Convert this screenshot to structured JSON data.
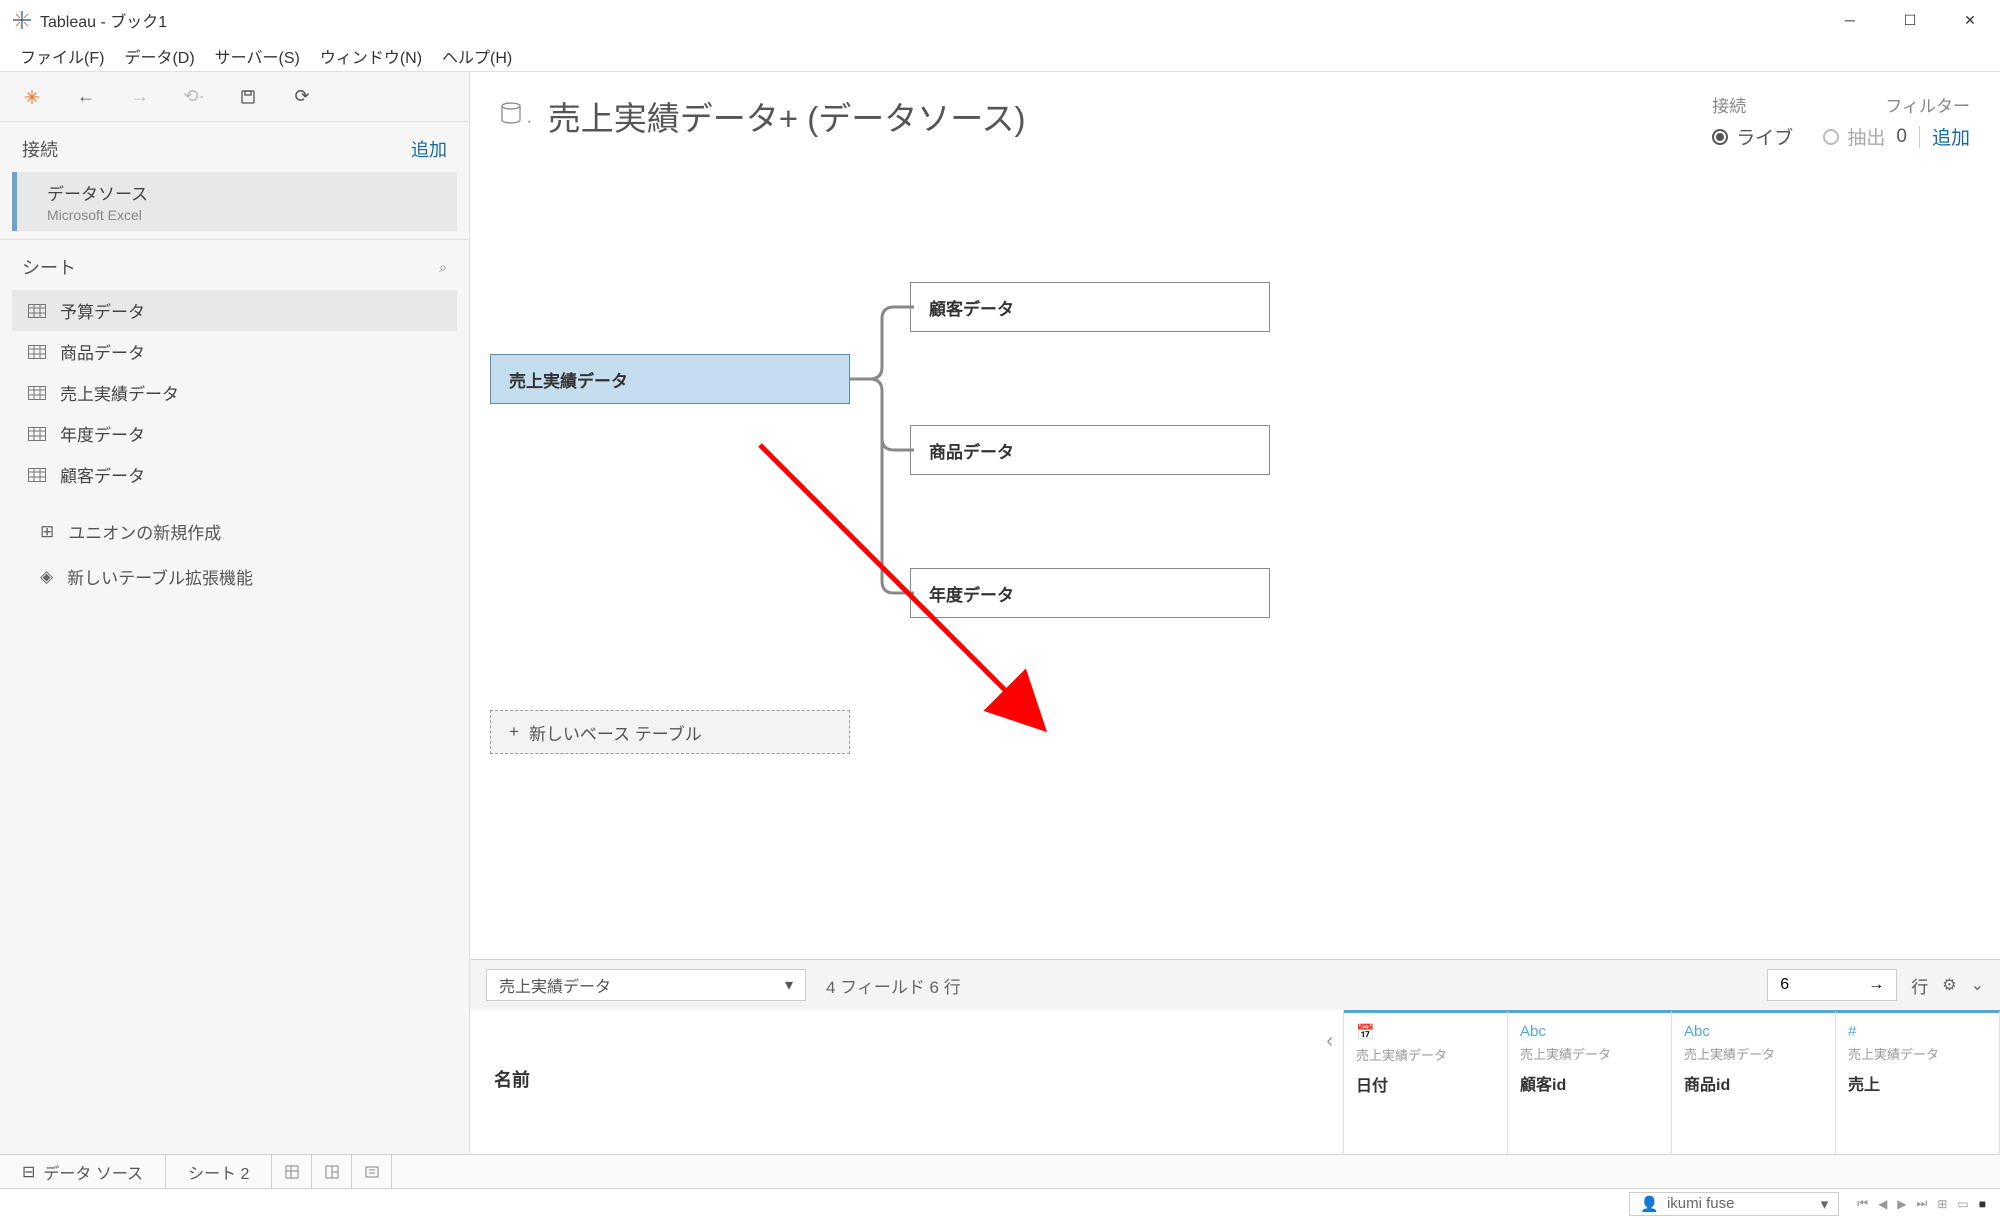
{
  "window": {
    "title": "Tableau - ブック1"
  },
  "menu": {
    "file": "ファイル(F)",
    "data": "データ(D)",
    "server": "サーバー(S)",
    "window": "ウィンドウ(N)",
    "help": "ヘルプ(H)"
  },
  "sidebar": {
    "connections_label": "接続",
    "add": "追加",
    "conn_name": "データソース",
    "conn_type": "Microsoft Excel",
    "sheets_label": "シート",
    "sheets": [
      {
        "label": "予算データ"
      },
      {
        "label": "商品データ"
      },
      {
        "label": "売上実績データ"
      },
      {
        "label": "年度データ"
      },
      {
        "label": "顧客データ"
      }
    ],
    "union": "ユニオンの新規作成",
    "extension": "新しいテーブル拡張機能"
  },
  "datasource": {
    "title": "売上実績データ+ (データソース)",
    "conn_label": "接続",
    "live": "ライブ",
    "extract": "抽出",
    "filter_label": "フィルター",
    "filter_count": "0",
    "filter_add": "追加"
  },
  "canvas": {
    "root": "売上実績データ",
    "n1": "顧客データ",
    "n2": "商品データ",
    "n3": "年度データ",
    "new_base": "新しいベース テーブル"
  },
  "preview": {
    "select": "売上実績データ",
    "info": "4 フィールド 6 行",
    "rows_value": "6",
    "rows_label": "行",
    "name_label": "名前",
    "cols": [
      {
        "icon": "date",
        "src": "売上実績データ",
        "name": "日付"
      },
      {
        "icon": "abc",
        "src": "売上実績データ",
        "name": "顧客id"
      },
      {
        "icon": "abc",
        "src": "売上実績データ",
        "name": "商品id"
      },
      {
        "icon": "num",
        "src": "売上実績データ",
        "name": "売上"
      }
    ]
  },
  "tabs": {
    "datasource": "データ ソース",
    "sheet": "シート 2"
  },
  "status": {
    "user": "ikumi fuse"
  }
}
